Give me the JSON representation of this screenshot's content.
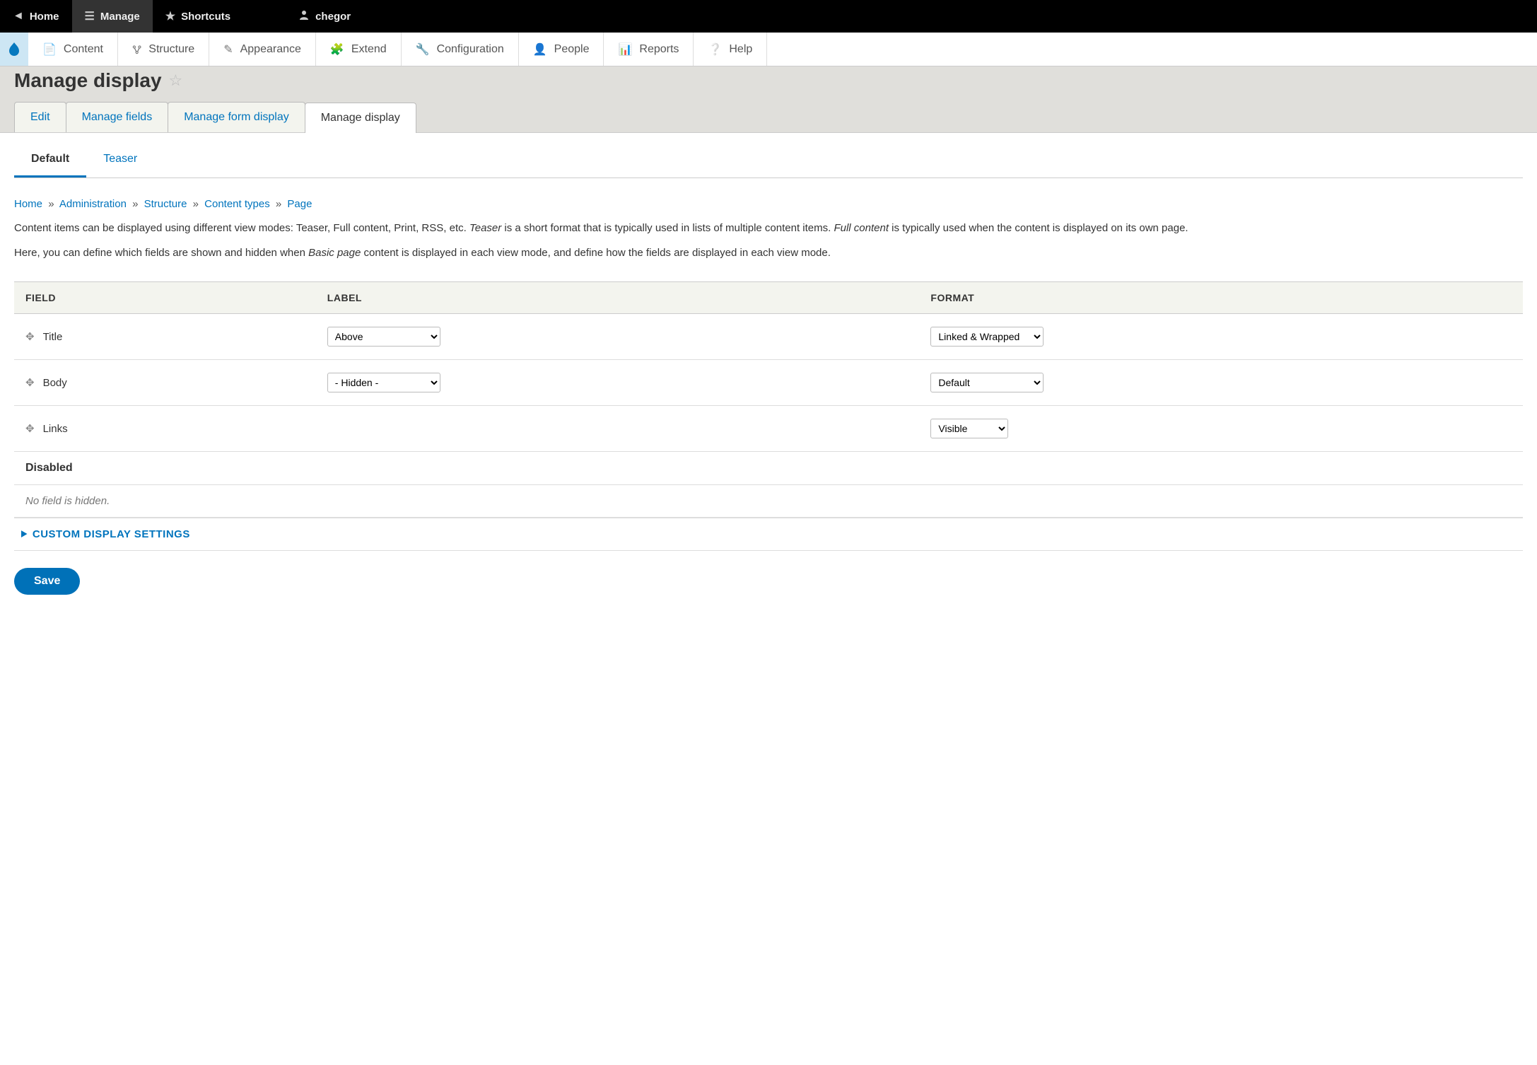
{
  "toolbar": {
    "home": "Home",
    "manage": "Manage",
    "shortcuts": "Shortcuts",
    "user": "chegor"
  },
  "adminmenu": {
    "content": "Content",
    "structure": "Structure",
    "appearance": "Appearance",
    "extend": "Extend",
    "configuration": "Configuration",
    "people": "People",
    "reports": "Reports",
    "help": "Help"
  },
  "page": {
    "title": "Manage display"
  },
  "primary_tabs": {
    "edit": "Edit",
    "manage_fields": "Manage fields",
    "manage_form": "Manage form display",
    "manage_display": "Manage display"
  },
  "secondary_tabs": {
    "default": "Default",
    "teaser": "Teaser"
  },
  "breadcrumbs": {
    "home": "Home",
    "admin": "Administration",
    "structure": "Structure",
    "content_types": "Content types",
    "page": "Page",
    "sep": "»"
  },
  "help": {
    "p1a": "Content items can be displayed using different view modes: Teaser, Full content, Print, RSS, etc. ",
    "p1b": "Teaser",
    "p1c": " is a short format that is typically used in lists of multiple content items. ",
    "p1d": "Full content",
    "p1e": " is typically used when the content is displayed on its own page.",
    "p2a": "Here, you can define which fields are shown and hidden when ",
    "p2b": "Basic page",
    "p2c": " content is displayed in each view mode, and define how the fields are displayed in each view mode."
  },
  "table": {
    "headers": {
      "field": "FIELD",
      "label": "LABEL",
      "format": "FORMAT"
    },
    "rows": [
      {
        "field": "Title",
        "label": "Above",
        "format": "Linked & Wrapped"
      },
      {
        "field": "Body",
        "label": "- Hidden -",
        "format": "Default"
      },
      {
        "field": "Links",
        "label": "",
        "format": "Visible"
      }
    ],
    "disabled_heading": "Disabled",
    "no_hidden": "No field is hidden."
  },
  "details": {
    "custom": "CUSTOM DISPLAY SETTINGS"
  },
  "buttons": {
    "save": "Save"
  }
}
